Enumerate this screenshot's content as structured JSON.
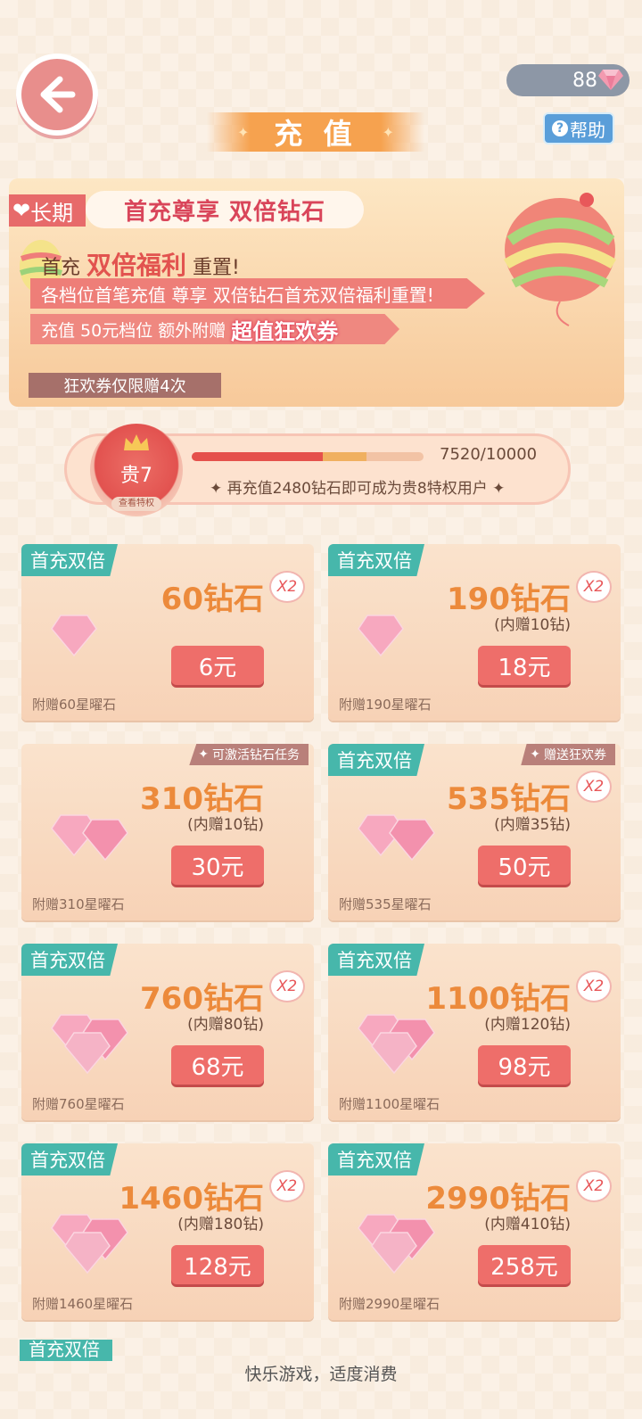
{
  "header": {
    "currency_value": "88",
    "title": "充 值",
    "help_label": "帮助"
  },
  "banner": {
    "tab_label": "长期",
    "headline": "首充尊享 双倍钻石",
    "line1_prefix": "首充",
    "line1_big": "双倍福利",
    "line1_suffix": "重置!",
    "line2": "各档位首笔充值 尊享 双倍钻石首充双倍福利重置!",
    "line3_text": "充值 50元档位 额外附赠",
    "line3_hot": "超值狂欢券",
    "limit": "狂欢券仅限赠4次"
  },
  "vip": {
    "level": "贵7",
    "lookup": "查看特权",
    "progress_text": "7520/10000",
    "progress_fraction": 0.752,
    "tip": "再充值2480钻石即可成为贵8特权用户"
  },
  "cards": [
    {
      "ribbon": "首充双倍",
      "amount": "60钻石",
      "bonus": "",
      "price": "6元",
      "gift": "附赠60星曜石",
      "x2": "X2",
      "promo": ""
    },
    {
      "ribbon": "首充双倍",
      "amount": "190钻石",
      "bonus": "(内赠10钻)",
      "price": "18元",
      "gift": "附赠190星曜石",
      "x2": "X2",
      "promo": ""
    },
    {
      "ribbon": "",
      "amount": "310钻石",
      "bonus": "(内赠10钻)",
      "price": "30元",
      "gift": "附赠310星曜石",
      "x2": "",
      "promo": "可激活钻石任务"
    },
    {
      "ribbon": "首充双倍",
      "amount": "535钻石",
      "bonus": "(内赠35钻)",
      "price": "50元",
      "gift": "附赠535星曜石",
      "x2": "X2",
      "promo": "赠送狂欢券"
    },
    {
      "ribbon": "首充双倍",
      "amount": "760钻石",
      "bonus": "(内赠80钻)",
      "price": "68元",
      "gift": "附赠760星曜石",
      "x2": "X2",
      "promo": ""
    },
    {
      "ribbon": "首充双倍",
      "amount": "1100钻石",
      "bonus": "(内赠120钻)",
      "price": "98元",
      "gift": "附赠1100星曜石",
      "x2": "X2",
      "promo": ""
    },
    {
      "ribbon": "首充双倍",
      "amount": "1460钻石",
      "bonus": "(内赠180钻)",
      "price": "128元",
      "gift": "附赠1460星曜石",
      "x2": "X2",
      "promo": ""
    },
    {
      "ribbon": "首充双倍",
      "amount": "2990钻石",
      "bonus": "(内赠410钻)",
      "price": "258元",
      "gift": "附赠2990星曜石",
      "x2": "X2",
      "promo": ""
    }
  ],
  "partial_ribbon": "首充双倍",
  "footer": "快乐游戏，适度消费",
  "colors": {
    "accent": "#ee6e6a",
    "ribbon": "#47b7ab",
    "amount": "#ec8a3b",
    "help": "#5a9ed9"
  }
}
